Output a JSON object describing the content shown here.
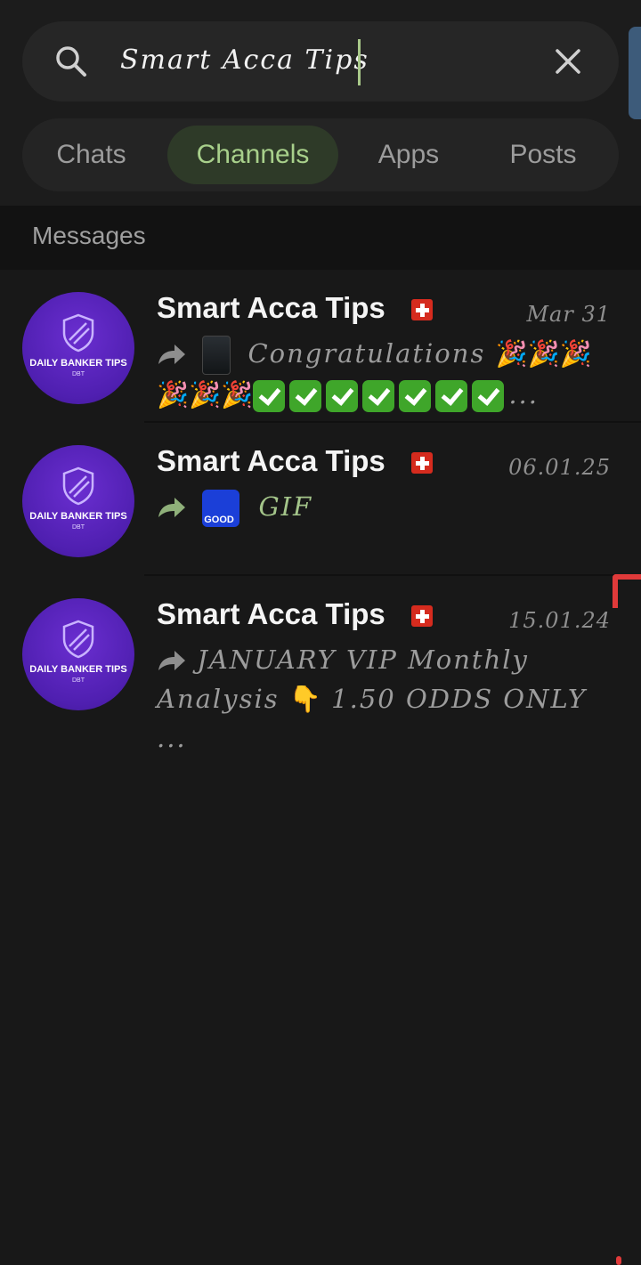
{
  "search": {
    "query": "Smart Acca Tips"
  },
  "tabs": [
    {
      "label": "Chats",
      "active": false
    },
    {
      "label": "Channels",
      "active": true
    },
    {
      "label": "Apps",
      "active": false
    },
    {
      "label": "Posts",
      "active": false
    }
  ],
  "section": {
    "title": "Messages"
  },
  "avatar": {
    "brand": "DAILY BANKER TIPS",
    "sub": "DBT"
  },
  "results": [
    {
      "name": "Smart Acca Tips",
      "date": "Mar 31",
      "preview_text": "Congratulations",
      "preview_more": "..."
    },
    {
      "name": "Smart Acca Tips",
      "date": "06.01.25",
      "preview_thumb": "GOOD MORNING",
      "preview_text": "GIF"
    },
    {
      "name": "Smart Acca Tips",
      "date": "15.01.24",
      "preview_text_1": "JANUARY VIP Monthly",
      "preview_text_2": "Analysis",
      "preview_text_3": "1.50 ODDS ONLY ..."
    }
  ],
  "colors": {
    "accent_green": "#a8d08b",
    "avatar_purple": "#5a24c0",
    "flag_red": "#d52b1e",
    "check_green": "#3fa62a",
    "marker_red": "#e03a3a"
  },
  "icons": {
    "search": "search-icon",
    "clear": "close-icon",
    "forward": "forward-arrow-icon",
    "flag": "swiss-flag-icon",
    "party": "party-popper-emoji",
    "check": "check-mark-emoji",
    "point": "pointing-down-emoji"
  }
}
